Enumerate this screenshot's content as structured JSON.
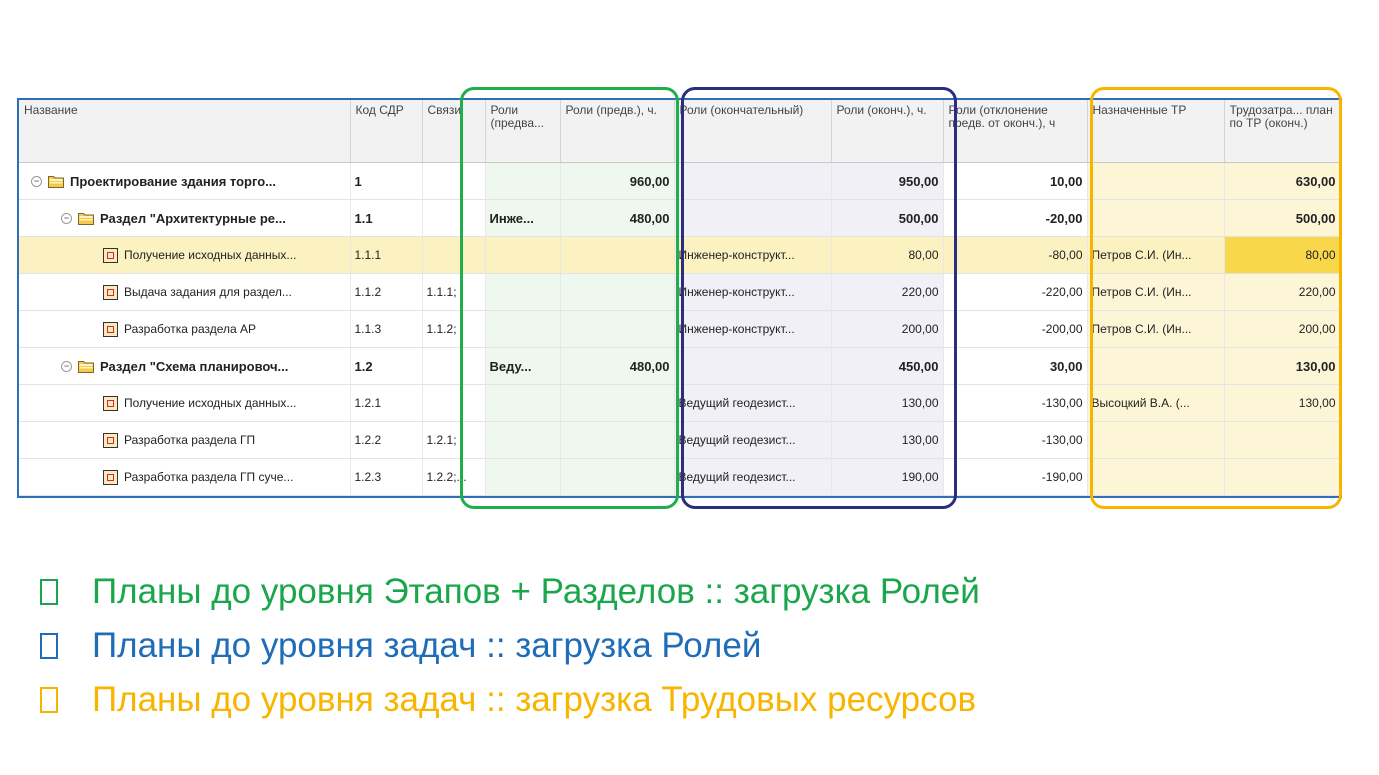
{
  "table": {
    "columns": [
      "Название",
      "Код СДР",
      "Связи",
      "Роли (предва...",
      "Роли (предв.), ч.",
      "Роли (окончательный)",
      "Роли (оконч.), ч.",
      "Роли (отклонение предв. от оконч.), ч",
      "Назначенные ТР",
      "Трудозатра... план по ТР (оконч.)"
    ],
    "rows": [
      {
        "name": "Проектирование здания торго...",
        "code": "1",
        "links": "",
        "role_pre": "",
        "hours_pre": "960,00",
        "role_fin": "",
        "hours_fin": "950,00",
        "dev": "10,00",
        "tr": "",
        "labor": "630,00"
      },
      {
        "name": "Раздел \"Архитектурные ре...",
        "code": "1.1",
        "links": "",
        "role_pre": "Инже...",
        "hours_pre": "480,00",
        "role_fin": "",
        "hours_fin": "500,00",
        "dev": "-20,00",
        "tr": "",
        "labor": "500,00"
      },
      {
        "name": "Получение исходных данных...",
        "code": "1.1.1",
        "links": "",
        "role_pre": "",
        "hours_pre": "",
        "role_fin": "Инженер-конструкт...",
        "hours_fin": "80,00",
        "dev": "-80,00",
        "tr": "Петров С.И. (Ин...",
        "labor": "80,00"
      },
      {
        "name": "Выдача задания для раздел...",
        "code": "1.1.2",
        "links": "1.1.1;",
        "role_pre": "",
        "hours_pre": "",
        "role_fin": "Инженер-конструкт...",
        "hours_fin": "220,00",
        "dev": "-220,00",
        "tr": "Петров С.И. (Ин...",
        "labor": "220,00"
      },
      {
        "name": "Разработка раздела АР",
        "code": "1.1.3",
        "links": "1.1.2;",
        "role_pre": "",
        "hours_pre": "",
        "role_fin": "Инженер-конструкт...",
        "hours_fin": "200,00",
        "dev": "-200,00",
        "tr": "Петров С.И. (Ин...",
        "labor": "200,00"
      },
      {
        "name": "Раздел \"Схема планировоч...",
        "code": "1.2",
        "links": "",
        "role_pre": "Веду...",
        "hours_pre": "480,00",
        "role_fin": "",
        "hours_fin": "450,00",
        "dev": "30,00",
        "tr": "",
        "labor": "130,00"
      },
      {
        "name": "Получение исходных данных...",
        "code": "1.2.1",
        "links": "",
        "role_pre": "",
        "hours_pre": "",
        "role_fin": "Ведущий геодезист...",
        "hours_fin": "130,00",
        "dev": "-130,00",
        "tr": "Высоцкий В.А. (...",
        "labor": "130,00"
      },
      {
        "name": "Разработка раздела ГП",
        "code": "1.2.2",
        "links": "1.2.1;",
        "role_pre": "",
        "hours_pre": "",
        "role_fin": "Ведущий геодезист...",
        "hours_fin": "130,00",
        "dev": "-130,00",
        "tr": "",
        "labor": ""
      },
      {
        "name": "Разработка раздела ГП суче...",
        "code": "1.2.3",
        "links": "1.2.2;...",
        "role_pre": "",
        "hours_pre": "",
        "role_fin": "Ведущий геодезист...",
        "hours_fin": "190,00",
        "dev": "-190,00",
        "tr": "",
        "labor": ""
      }
    ]
  },
  "bullets": [
    {
      "text": "Планы до уровня Этапов + Разделов :: загрузка Ролей",
      "color": "#1aa64a"
    },
    {
      "text": "Планы до уровня задач :: загрузка Ролей",
      "color": "#1f6db8"
    },
    {
      "text": "Планы до уровня задач :: загрузка Трудовых ресурсов",
      "color": "#f7b500"
    }
  ]
}
